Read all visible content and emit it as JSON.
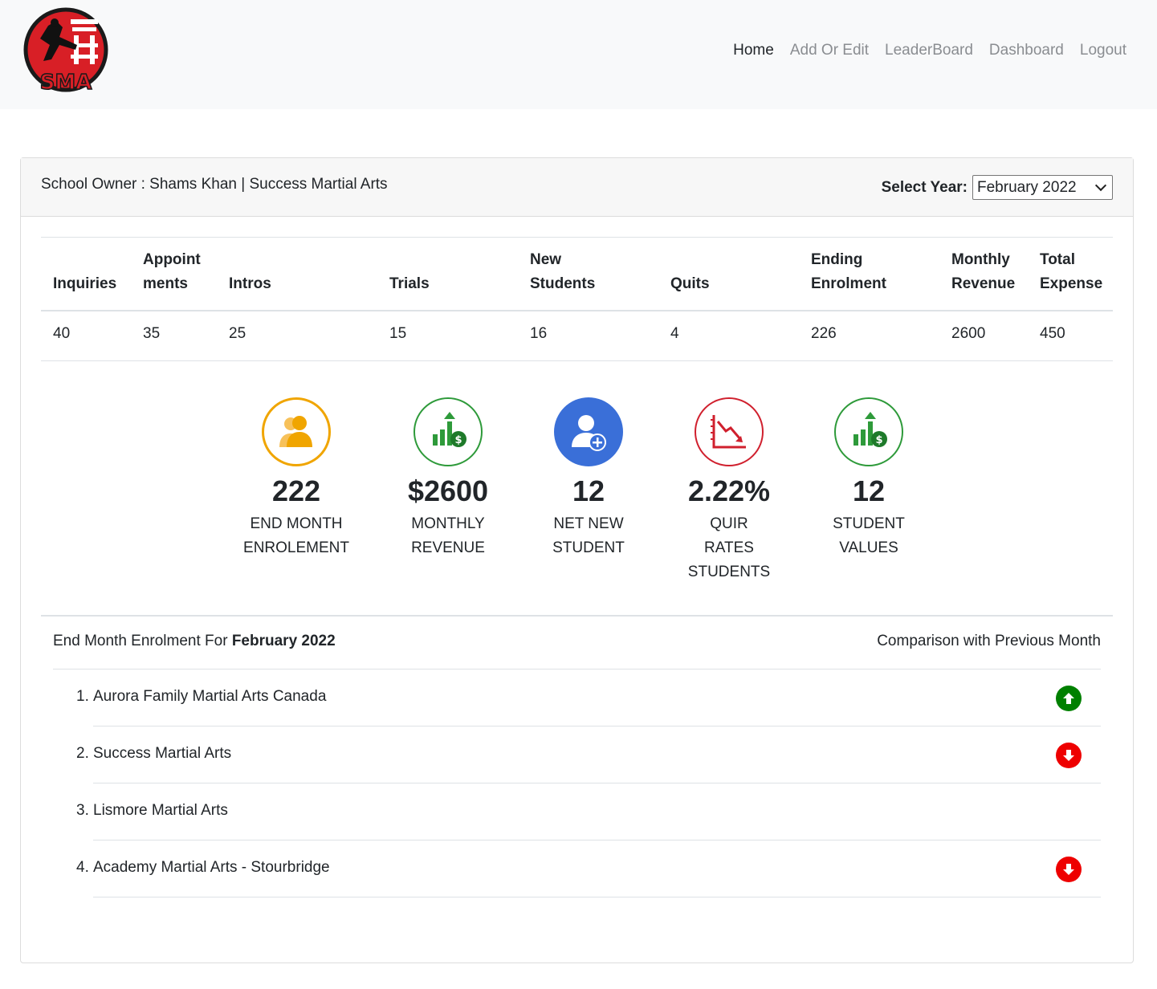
{
  "nav": {
    "logo_text": "SMA",
    "links": [
      "Home",
      "Add Or Edit",
      "LeaderBoard",
      "Dashboard",
      "Logout"
    ],
    "active": "Home"
  },
  "header": {
    "owner_text": "School Owner : Shams Khan | Success Martial Arts",
    "year_label": "Select Year:",
    "year_value": "February 2022"
  },
  "table": {
    "headers": [
      [
        "Inquiries"
      ],
      [
        "Appoint",
        "ments"
      ],
      [
        "Intros"
      ],
      [
        "Trials"
      ],
      [
        "New",
        "Students"
      ],
      [
        "Quits"
      ],
      [
        "Ending",
        "Enrolment"
      ],
      [
        "Monthly",
        "Revenue"
      ],
      [
        "Total",
        "Expense"
      ]
    ],
    "values": [
      "40",
      "35",
      "25",
      "15",
      "16",
      "4",
      "226",
      "2600",
      "450"
    ]
  },
  "kpis": [
    {
      "value": "222",
      "label_lines": [
        "END MONTH",
        "ENROLEMENT"
      ],
      "icon": "users-icon",
      "color": "#f0a500"
    },
    {
      "value": "$2600",
      "label_lines": [
        "MONTHLY",
        "REVENUE"
      ],
      "icon": "revenue-chart-icon",
      "color": "#2e9a3a"
    },
    {
      "value": "12",
      "label_lines": [
        "NET NEW",
        "STUDENT"
      ],
      "icon": "add-user-icon",
      "color": "#3a6fd8"
    },
    {
      "value": "2.22%",
      "label_lines": [
        "QUIR",
        "RATES",
        "STUDENTS"
      ],
      "icon": "decline-chart-icon",
      "color": "#d0202e"
    },
    {
      "value": "12",
      "label_lines": [
        "STUDENT",
        "VALUES"
      ],
      "icon": "revenue-chart-icon",
      "color": "#2e9a3a"
    }
  ],
  "enrolment": {
    "title_prefix": "End Month Enrolment For ",
    "title_month": "February 2022",
    "comparison_label": "Comparison with Previous Month",
    "items": [
      {
        "num": "1.",
        "name": "Aurora Family Martial Arts Canada",
        "trend": "up"
      },
      {
        "num": "2.",
        "name": "Success Martial Arts",
        "trend": "down"
      },
      {
        "num": "3.",
        "name": "Lismore Martial Arts",
        "trend": "none"
      },
      {
        "num": "4.",
        "name": "Academy Martial Arts - Stourbridge",
        "trend": "down"
      }
    ],
    "up_color": "#008000",
    "down_color": "#ee0000"
  }
}
